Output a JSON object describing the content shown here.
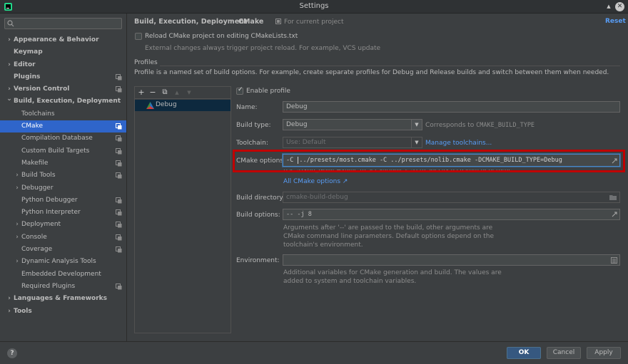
{
  "window": {
    "title": "Settings",
    "max_glyph": "▲",
    "close_glyph": "✕"
  },
  "sidebar": {
    "search_placeholder": "Q-",
    "items": [
      {
        "label": "Appearance & Behavior",
        "level": 0,
        "expander": "collapsed",
        "bold": true,
        "project_icon": false
      },
      {
        "label": "Keymap",
        "level": 0,
        "expander": "none",
        "bold": true,
        "project_icon": false
      },
      {
        "label": "Editor",
        "level": 0,
        "expander": "collapsed",
        "bold": true,
        "project_icon": false
      },
      {
        "label": "Plugins",
        "level": 0,
        "expander": "none",
        "bold": true,
        "project_icon": true
      },
      {
        "label": "Version Control",
        "level": 0,
        "expander": "collapsed",
        "bold": true,
        "project_icon": true
      },
      {
        "label": "Build, Execution, Deployment",
        "level": 0,
        "expander": "expanded",
        "bold": true,
        "project_icon": false
      },
      {
        "label": "Toolchains",
        "level": 1,
        "expander": "none",
        "bold": false,
        "project_icon": false
      },
      {
        "label": "CMake",
        "level": 1,
        "expander": "none",
        "bold": false,
        "project_icon": true,
        "selected": true
      },
      {
        "label": "Compilation Database",
        "level": 1,
        "expander": "none",
        "bold": false,
        "project_icon": true
      },
      {
        "label": "Custom Build Targets",
        "level": 1,
        "expander": "none",
        "bold": false,
        "project_icon": true
      },
      {
        "label": "Makefile",
        "level": 1,
        "expander": "none",
        "bold": false,
        "project_icon": true
      },
      {
        "label": "Build Tools",
        "level": 1,
        "expander": "collapsed",
        "bold": false,
        "project_icon": true
      },
      {
        "label": "Debugger",
        "level": 1,
        "expander": "collapsed",
        "bold": false,
        "project_icon": false
      },
      {
        "label": "Python Debugger",
        "level": 1,
        "expander": "none",
        "bold": false,
        "project_icon": true
      },
      {
        "label": "Python Interpreter",
        "level": 1,
        "expander": "none",
        "bold": false,
        "project_icon": true
      },
      {
        "label": "Deployment",
        "level": 1,
        "expander": "collapsed",
        "bold": false,
        "project_icon": true
      },
      {
        "label": "Console",
        "level": 1,
        "expander": "collapsed",
        "bold": false,
        "project_icon": true
      },
      {
        "label": "Coverage",
        "level": 1,
        "expander": "none",
        "bold": false,
        "project_icon": true
      },
      {
        "label": "Dynamic Analysis Tools",
        "level": 1,
        "expander": "collapsed",
        "bold": false,
        "project_icon": false
      },
      {
        "label": "Embedded Development",
        "level": 1,
        "expander": "none",
        "bold": false,
        "project_icon": false
      },
      {
        "label": "Required Plugins",
        "level": 1,
        "expander": "none",
        "bold": false,
        "project_icon": true
      },
      {
        "label": "Languages & Frameworks",
        "level": 0,
        "expander": "collapsed",
        "bold": true,
        "project_icon": false
      },
      {
        "label": "Tools",
        "level": 0,
        "expander": "collapsed",
        "bold": true,
        "project_icon": false
      }
    ]
  },
  "header": {
    "breadcrumb_1": "Build, Execution, Deployment",
    "separator": "›",
    "breadcrumb_2": "CMake",
    "scope": "For current project",
    "reset": "Reset"
  },
  "reload": {
    "label": "Reload CMake project on editing CMakeLists.txt",
    "checked": false,
    "note": "External changes always trigger project reload. For example, VCS update"
  },
  "profiles": {
    "heading": "Profiles",
    "description": "Profile is a named set of build options. For example, create separate profiles for Debug and Release builds and switch between them when needed.",
    "toolbar": {
      "add": "+",
      "remove": "−",
      "copy": "⧉",
      "up": "▲",
      "down": "▼"
    },
    "list": [
      "Debug"
    ]
  },
  "form": {
    "enable_profile": "Enable profile",
    "name_label": "Name:",
    "name_value": "Debug",
    "build_type_label": "Build type:",
    "build_type_value": "Debug",
    "build_type_hint_prefix": "Corresponds to",
    "build_type_hint_code": "CMAKE_BUILD_TYPE",
    "toolchain_label": "Toolchain:",
    "toolchain_value": "Use: Default",
    "manage_toolchains": "Manage toolchains...",
    "cmake_options_label": "CMake options:",
    "cmake_options_value_before_caret": "-C ",
    "cmake_options_value_after_caret": "../presets/most.cmake -C ../presets/nolib.cmake -DCMAKE_BUILD_TYPE=Debug",
    "cmake_options_hint": "Use -DVAR_NAME=value to set variables, -G to specify a custom generator.",
    "all_cmake_options": "All CMake options ↗",
    "build_dir_label": "Build directory:",
    "build_dir_value": "cmake-build-debug",
    "build_options_label": "Build options:",
    "build_options_value": "-- -j 8",
    "build_options_note_1": "Arguments after '--' are passed to the build, other arguments are",
    "build_options_note_2": "CMake command line parameters. Default options depend on the",
    "build_options_note_3": "toolchain's environment.",
    "environment_label": "Environment:",
    "environment_value": "",
    "environment_note_1": "Additional variables for CMake generation and build. The values are",
    "environment_note_2": "added to system and toolchain variables."
  },
  "footer": {
    "help": "?",
    "ok": "OK",
    "cancel": "Cancel",
    "apply": "Apply"
  },
  "colors": {
    "accent": "#2f65ca",
    "link": "#589df6",
    "highlight_box": "#c00000",
    "background": "#3c3f41"
  }
}
